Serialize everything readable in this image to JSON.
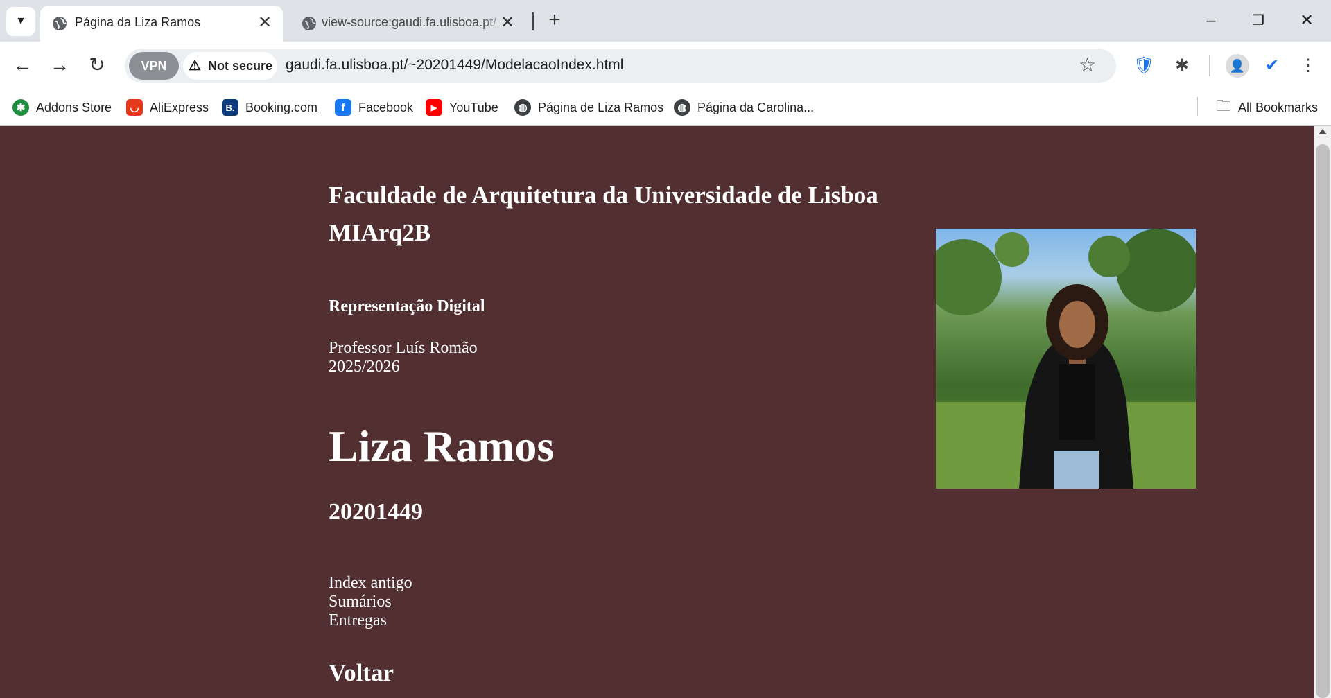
{
  "browser": {
    "tabs": [
      {
        "title": "Página da Liza Ramos",
        "active": true
      },
      {
        "title": "view-source:gaudi.fa.ulisboa.pt/",
        "active": false
      }
    ],
    "vpn_label": "VPN",
    "security_label": "Not secure",
    "url": "gaudi.fa.ulisboa.pt/~20201449/ModelacaoIndex.html",
    "bookmarks": [
      {
        "label": "Addons Store",
        "icon": "addons-store-icon",
        "color": "#1e8e3e",
        "glyph": "✱"
      },
      {
        "label": "AliExpress",
        "icon": "aliexpress-icon",
        "color": "#e5391b",
        "glyph": "◡"
      },
      {
        "label": "Booking.com",
        "icon": "booking-icon",
        "color": "#0c3b7c",
        "glyph": "B."
      },
      {
        "label": "Facebook",
        "icon": "facebook-icon",
        "color": "#1877f2",
        "glyph": "f"
      },
      {
        "label": "YouTube",
        "icon": "youtube-icon",
        "color": "#ff0000",
        "glyph": "▶"
      },
      {
        "label": "Página de Liza Ramos",
        "icon": "globe-icon",
        "color": "#3c4043",
        "glyph": "◍"
      },
      {
        "label": "Página da Carolina...",
        "icon": "globe-icon",
        "color": "#3c4043",
        "glyph": "◍"
      }
    ],
    "all_bookmarks_label": "All Bookmarks"
  },
  "page": {
    "faculty": "Faculdade de Arquitetura da Universidade de Lisboa",
    "class": "MIArq2B",
    "subject": "Representação Digital",
    "professor": "Professor Luís Romão",
    "year": "2025/2026",
    "student_name": "Liza Ramos",
    "student_number": "20201449",
    "links": [
      "Index antigo",
      "Sumários",
      "Entregas"
    ],
    "back_label": "Voltar",
    "background_color": "#522f30"
  }
}
